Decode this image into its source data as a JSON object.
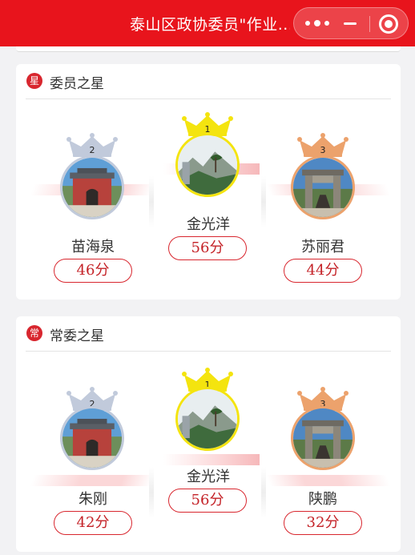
{
  "app": {
    "title": "泰山区政协委员\"作业...",
    "menu_icon": "more-dots-icon",
    "minimize_icon": "minimize-icon",
    "close_icon": "target-close-icon",
    "accent": "#e8141c"
  },
  "sections": [
    {
      "badge": "星",
      "title": "委员之星",
      "first": {
        "rank": "1",
        "name": "金光洋",
        "score": "56分"
      },
      "second": {
        "rank": "2",
        "name": "苗海泉",
        "score": "46分"
      },
      "third": {
        "rank": "3",
        "name": "苏丽君",
        "score": "44分"
      }
    },
    {
      "badge": "常",
      "title": "常委之星",
      "first": {
        "rank": "1",
        "name": "金光洋",
        "score": "56分"
      },
      "second": {
        "rank": "2",
        "name": "朱刚",
        "score": "42分"
      },
      "third": {
        "rank": "3",
        "name": "陕鹏",
        "score": "32分"
      }
    }
  ],
  "colors": {
    "gold": "#f4e40f",
    "silver": "#c1cadb",
    "bronze": "#eca26c",
    "score_red": "#c42227"
  }
}
